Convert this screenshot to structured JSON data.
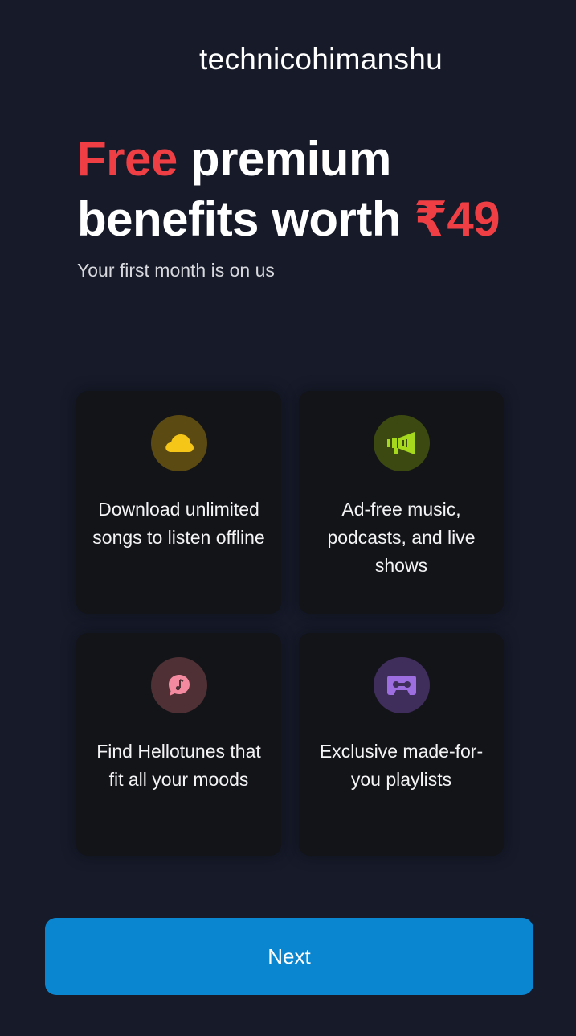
{
  "watermark": "technicohimanshu",
  "headline": {
    "word_free": "Free",
    "word_premium": " premium",
    "line2_text": "benefits worth ",
    "price": "₹49"
  },
  "subtitle": "Your first month is on us",
  "benefits": [
    {
      "text": "Download unlimited songs to listen offline",
      "icon": "cloud-icon",
      "circle_color": "#5b4a12",
      "icon_color": "#f5c518"
    },
    {
      "text": "Ad-free music, podcasts, and live shows",
      "icon": "megaphone-icon",
      "circle_color": "#3c4a12",
      "icon_color": "#a6d81e"
    },
    {
      "text": "Find Hellotunes that fit all your moods",
      "icon": "music-note-bubble-icon",
      "circle_color": "#4e3035",
      "icon_color": "#f48aa0"
    },
    {
      "text": "Exclusive made-for-you playlists",
      "icon": "cassette-icon",
      "circle_color": "#3f2d5c",
      "icon_color": "#9c6ee0"
    }
  ],
  "next_button": {
    "label": "Next",
    "color": "#0a86d1"
  },
  "colors": {
    "background": "#161a29",
    "accent": "#ef3f44",
    "card": "#131418"
  }
}
